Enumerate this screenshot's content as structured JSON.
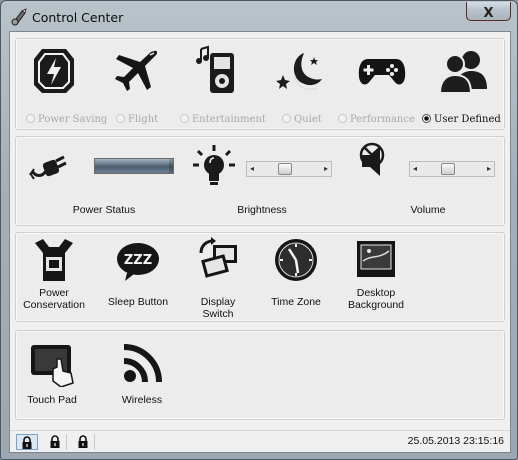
{
  "window": {
    "title": "Control Center",
    "close_label": "X"
  },
  "modes": [
    {
      "label": "Power Saving",
      "icon": "battery-shield-icon",
      "selected": false
    },
    {
      "label": "Flight",
      "icon": "airplane-icon",
      "selected": false
    },
    {
      "label": "Entertainment",
      "icon": "music-player-icon",
      "selected": false
    },
    {
      "label": "Quiet",
      "icon": "moon-stars-icon",
      "selected": false
    },
    {
      "label": "Performance",
      "icon": "gamepad-icon",
      "selected": false
    },
    {
      "label": "User Defined",
      "icon": "users-icon",
      "selected": true
    }
  ],
  "settings": {
    "power_status": "Power Status",
    "brightness": "Brightness",
    "volume": "Volume",
    "power_status_level": 0.95,
    "brightness_level": 0.4,
    "volume_level": 0.4
  },
  "controls": [
    {
      "label": "Power Conservation",
      "icon": "power-conservation-icon"
    },
    {
      "label": "Sleep Button",
      "icon": "zzz-icon"
    },
    {
      "label": "Display Switch",
      "icon": "display-switch-icon"
    },
    {
      "label": "Time Zone",
      "icon": "clock-icon"
    },
    {
      "label": "Desktop Background",
      "icon": "desktop-background-icon"
    }
  ],
  "devices": [
    {
      "label": "Touch Pad",
      "icon": "touchpad-icon"
    },
    {
      "label": "Wireless",
      "icon": "wireless-icon"
    }
  ],
  "status": {
    "datetime": "25.05.2013 23:15:16"
  }
}
